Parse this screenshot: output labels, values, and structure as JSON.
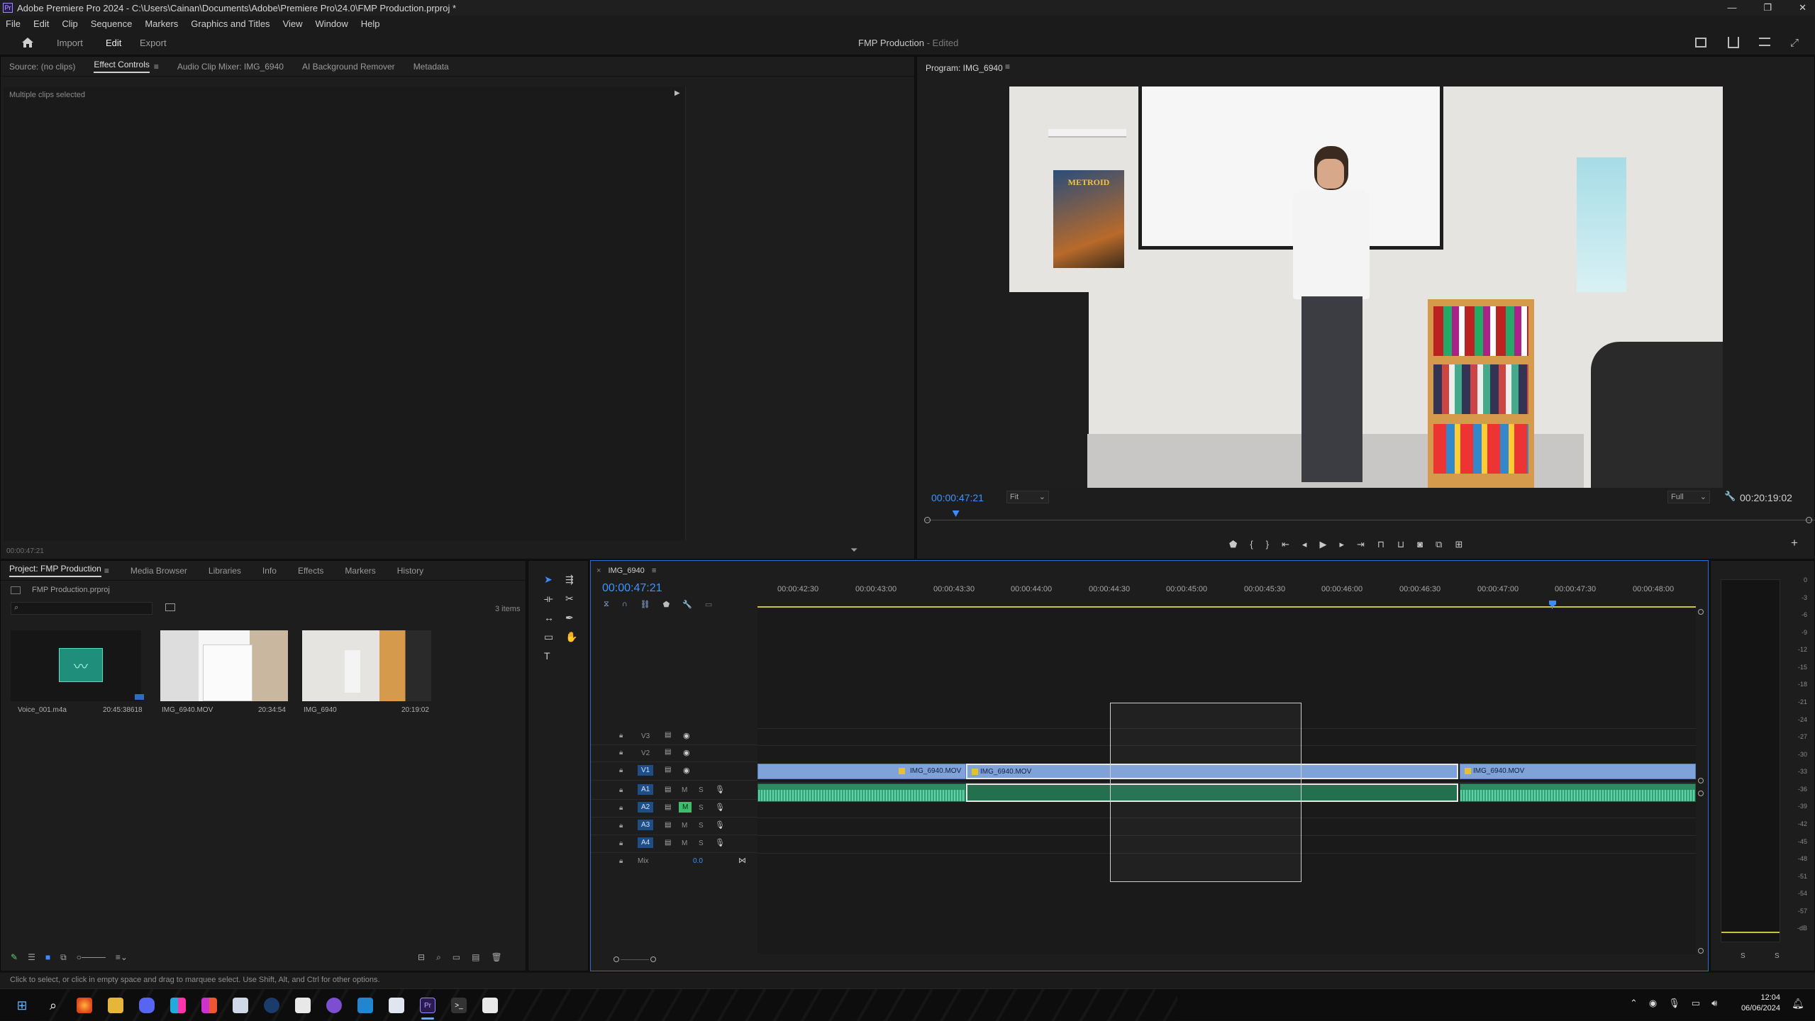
{
  "window": {
    "title": "Adobe Premiere Pro 2024 - C:\\Users\\Cainan\\Documents\\Adobe\\Premiere Pro\\24.0\\FMP Production.prproj *",
    "controls": [
      "—",
      "❐",
      "✕"
    ]
  },
  "menu": [
    "File",
    "Edit",
    "Clip",
    "Sequence",
    "Markers",
    "Graphics and Titles",
    "View",
    "Window",
    "Help"
  ],
  "workspace": {
    "tabs": [
      "Import",
      "Edit",
      "Export"
    ],
    "active": "Edit",
    "project_title": "FMP Production",
    "project_state": "- Edited"
  },
  "source_panel": {
    "tabs": [
      "Source: (no clips)",
      "Effect Controls",
      "Audio Clip Mixer: IMG_6940",
      "AI Background Remover",
      "Metadata"
    ],
    "active": "Effect Controls",
    "status": "Multiple clips selected",
    "timecode": "00:00:47:21"
  },
  "program_panel": {
    "title": "Program: IMG_6940",
    "timecode_current": "00:00:47:21",
    "timecode_duration": "00:20:19:02",
    "fit": "Fit",
    "resolution": "Full",
    "poster_text": "METROID",
    "playhead_fraction": 0.03
  },
  "project_panel": {
    "tabs": [
      "Project: FMP Production",
      "Media Browser",
      "Libraries",
      "Info",
      "Effects",
      "Markers",
      "History"
    ],
    "active": "Project: FMP Production",
    "project_file": "FMP Production.prproj",
    "item_count": "3 items",
    "items": [
      {
        "name": "Voice_001.m4a",
        "duration": "20:45:38618",
        "kind": "audio"
      },
      {
        "name": "IMG_6940.MOV",
        "duration": "20:34:54",
        "kind": "video"
      },
      {
        "name": "IMG_6940",
        "duration": "20:19:02",
        "kind": "sequence"
      }
    ]
  },
  "timeline": {
    "sequence_tab": "IMG_6940",
    "timecode": "00:00:47:21",
    "ruler": [
      "00:00:42:30",
      "00:00:43:00",
      "00:00:43:30",
      "00:00:44:00",
      "00:00:44:30",
      "00:00:45:00",
      "00:00:45:30",
      "00:00:46:00",
      "00:00:46:30",
      "00:00:47:00",
      "00:00:47:30",
      "00:00:48:00"
    ],
    "video_tracks": [
      "V3",
      "V2",
      "V1"
    ],
    "audio_tracks": [
      "A1",
      "A2",
      "A3",
      "A4"
    ],
    "mix_label": "Mix",
    "mix_value": "0.0",
    "clip_name": "IMG_6940.MOV",
    "track_button_m": "M",
    "track_button_s": "S"
  },
  "meter": {
    "ticks": [
      "0",
      "-3",
      "-6",
      "-9",
      "-12",
      "-15",
      "-18",
      "-21",
      "-24",
      "-27",
      "-30",
      "-33",
      "-36",
      "-39",
      "-42",
      "-45",
      "-48",
      "-51",
      "-54",
      "-57",
      "-dB"
    ],
    "solo_left": "S",
    "solo_right": "S"
  },
  "status_bar": "Click to select, or click in empty space and drag to marquee select. Use Shift, Alt, and Ctrl for other options.",
  "taskbar": {
    "time": "12:04",
    "date": "06/06/2024",
    "icons": [
      "windows-start",
      "search",
      "firefox",
      "file-explorer",
      "discord",
      "app-a",
      "app-b",
      "notepad",
      "steam",
      "mail",
      "github",
      "vscode",
      "tool",
      "premiere",
      "terminal",
      "excel"
    ]
  },
  "colors": {
    "accent_blue": "#2d8ceb",
    "video_clip": "#7fa2d8",
    "audio_clip": "#2f8a64",
    "playhead": "#3d8bff"
  }
}
